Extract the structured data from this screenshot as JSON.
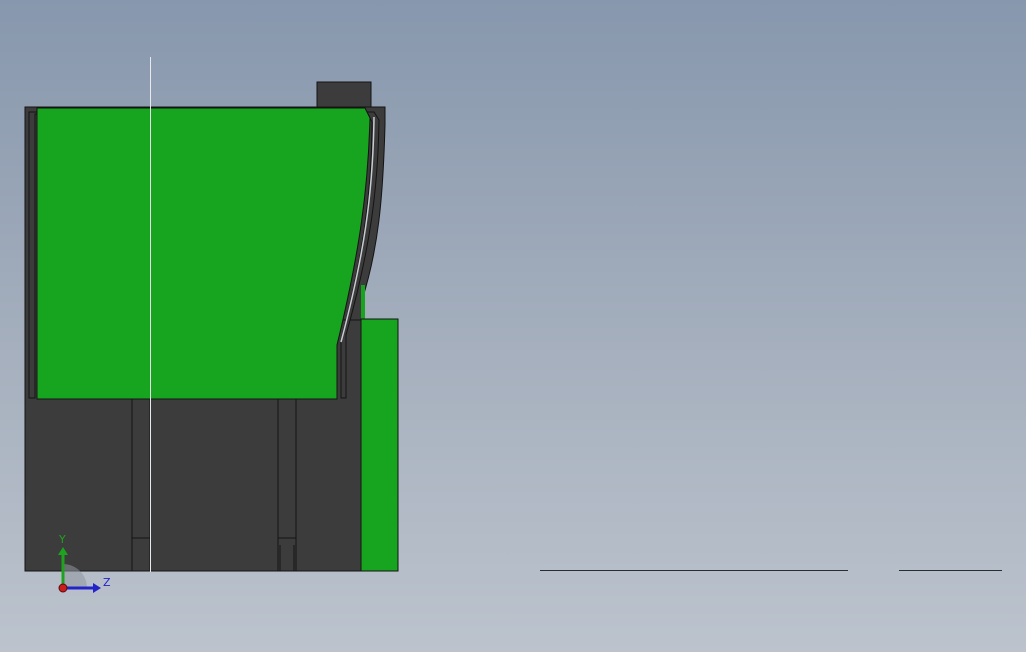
{
  "viewport": {
    "background_top": "#8797ad",
    "background_bottom": "#bcc3cd"
  },
  "model": {
    "body_color": "#3c3c3c",
    "green_color": "#17a41e",
    "edge_color": "#141414"
  },
  "triad": {
    "y_label": "Y",
    "z_label": "Z",
    "y_color": "#1fa21f",
    "z_color": "#2323c8",
    "origin_color": "#c81e1e"
  }
}
